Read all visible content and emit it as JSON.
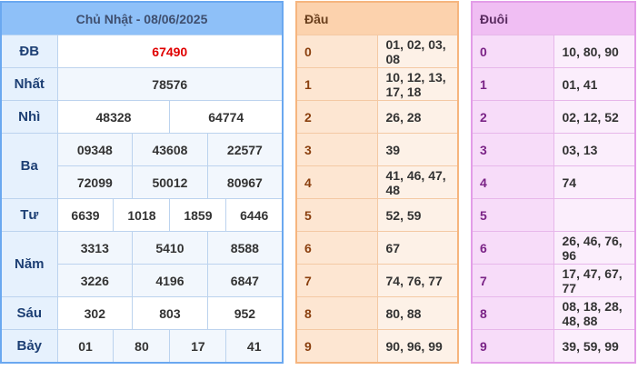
{
  "results": {
    "title": "Chủ Nhật - 08/06/2025",
    "rows": [
      {
        "label": "ĐB",
        "values": [
          "67490"
        ]
      },
      {
        "label": "Nhất",
        "values": [
          "78576"
        ]
      },
      {
        "label": "Nhì",
        "values": [
          "48328",
          "64774"
        ]
      },
      {
        "label": "Ba",
        "values": [
          "09348",
          "43608",
          "22577",
          "72099",
          "50012",
          "80967"
        ]
      },
      {
        "label": "Tư",
        "values": [
          "6639",
          "1018",
          "1859",
          "6446"
        ]
      },
      {
        "label": "Năm",
        "values": [
          "3313",
          "5410",
          "8588",
          "3226",
          "4196",
          "6847"
        ]
      },
      {
        "label": "Sáu",
        "values": [
          "302",
          "803",
          "952"
        ]
      },
      {
        "label": "Bảy",
        "values": [
          "01",
          "80",
          "17",
          "41"
        ]
      }
    ]
  },
  "head": {
    "title": "Đầu",
    "rows": [
      {
        "digit": "0",
        "values": "01, 02, 03, 08"
      },
      {
        "digit": "1",
        "values": "10, 12, 13, 17, 18"
      },
      {
        "digit": "2",
        "values": "26, 28"
      },
      {
        "digit": "3",
        "values": "39"
      },
      {
        "digit": "4",
        "values": "41, 46, 47, 48"
      },
      {
        "digit": "5",
        "values": "52, 59"
      },
      {
        "digit": "6",
        "values": "67"
      },
      {
        "digit": "7",
        "values": "74, 76, 77"
      },
      {
        "digit": "8",
        "values": "80, 88"
      },
      {
        "digit": "9",
        "values": "90, 96, 99"
      }
    ]
  },
  "tail": {
    "title": "Đuôi",
    "rows": [
      {
        "digit": "0",
        "values": "10, 80, 90"
      },
      {
        "digit": "1",
        "values": "01, 41"
      },
      {
        "digit": "2",
        "values": "02, 12, 52"
      },
      {
        "digit": "3",
        "values": "03, 13"
      },
      {
        "digit": "4",
        "values": "74"
      },
      {
        "digit": "5",
        "values": ""
      },
      {
        "digit": "6",
        "values": "26, 46, 76, 96"
      },
      {
        "digit": "7",
        "values": "17, 47, 67, 77"
      },
      {
        "digit": "8",
        "values": "08, 18, 28, 48, 88"
      },
      {
        "digit": "9",
        "values": "39, 59, 99"
      }
    ]
  },
  "colors": {
    "special_prize": "#e00000",
    "results_accent": "#8ec0f8",
    "head_accent": "#fcd2ad",
    "tail_accent": "#f0bef3"
  }
}
